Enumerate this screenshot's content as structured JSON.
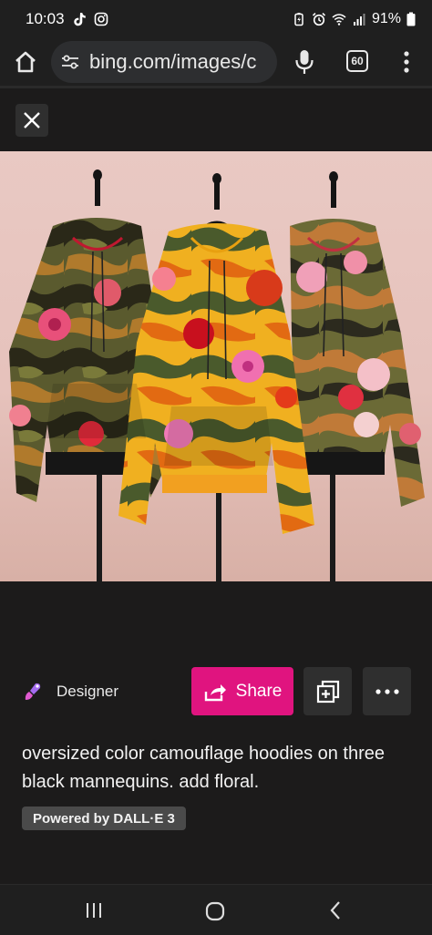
{
  "status_bar": {
    "time": "10:03",
    "battery": "91%",
    "icons": [
      "tiktok-icon",
      "instagram-icon",
      "battery-saver-icon",
      "alarm-icon",
      "wifi-icon",
      "signal-icon",
      "battery-icon"
    ]
  },
  "browser": {
    "url": "bing.com/images/c",
    "tab_count": "60",
    "icons": [
      "home-icon",
      "tune-icon",
      "mic-icon",
      "tabs-icon",
      "menu-dots-icon"
    ]
  },
  "viewer": {
    "close_icon": "close-icon",
    "image_alt": "Three oversized camouflage hoodies with floral prints on black mannequins"
  },
  "actions": {
    "designer_label": "Designer",
    "share_label": "Share",
    "save_icon": "add-to-collection-icon",
    "more_icon": "more-dots-icon"
  },
  "caption": "oversized color camouflage hoodies on three black mannequins. add floral.",
  "badge": "Powered by DALL·E 3",
  "colors": {
    "share_accent": "#e0147f",
    "background": "#1c1b1b",
    "button_bg": "#2f2f2f"
  },
  "nav": {
    "icons": [
      "recent-apps-icon",
      "home-nav-icon",
      "back-icon"
    ]
  }
}
